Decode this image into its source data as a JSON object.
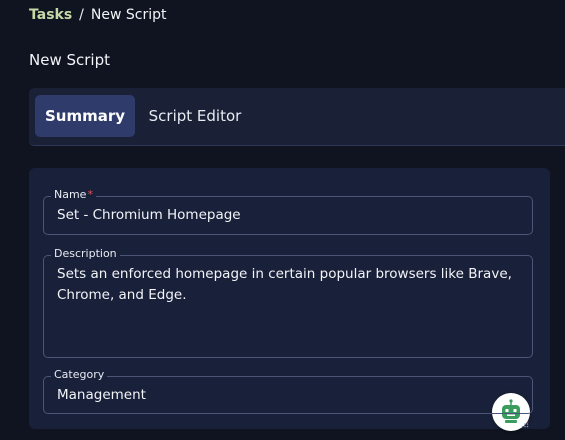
{
  "breadcrumb": {
    "parent": "Tasks",
    "separator": "/",
    "current": "New Script"
  },
  "page_title": "New Script",
  "tabs": [
    {
      "label": "Summary",
      "active": true
    },
    {
      "label": "Script Editor",
      "active": false
    }
  ],
  "form": {
    "name": {
      "label": "Name",
      "required_marker": "*",
      "value": "Set - Chromium Homepage"
    },
    "description": {
      "label": "Description",
      "value": "Sets an enforced homepage in certain popular browsers like Brave, Chrome, and Edge."
    },
    "category": {
      "label": "Category",
      "value": "Management"
    },
    "assistant_icon": "robot-assistant-icon"
  },
  "colors": {
    "background": "#0f1420",
    "panel": "#192039",
    "tab_active": "#2f3b6b",
    "breadcrumb_link": "#c7d9a7",
    "required": "#e0505a",
    "assistant_green": "#3a9d5d"
  }
}
